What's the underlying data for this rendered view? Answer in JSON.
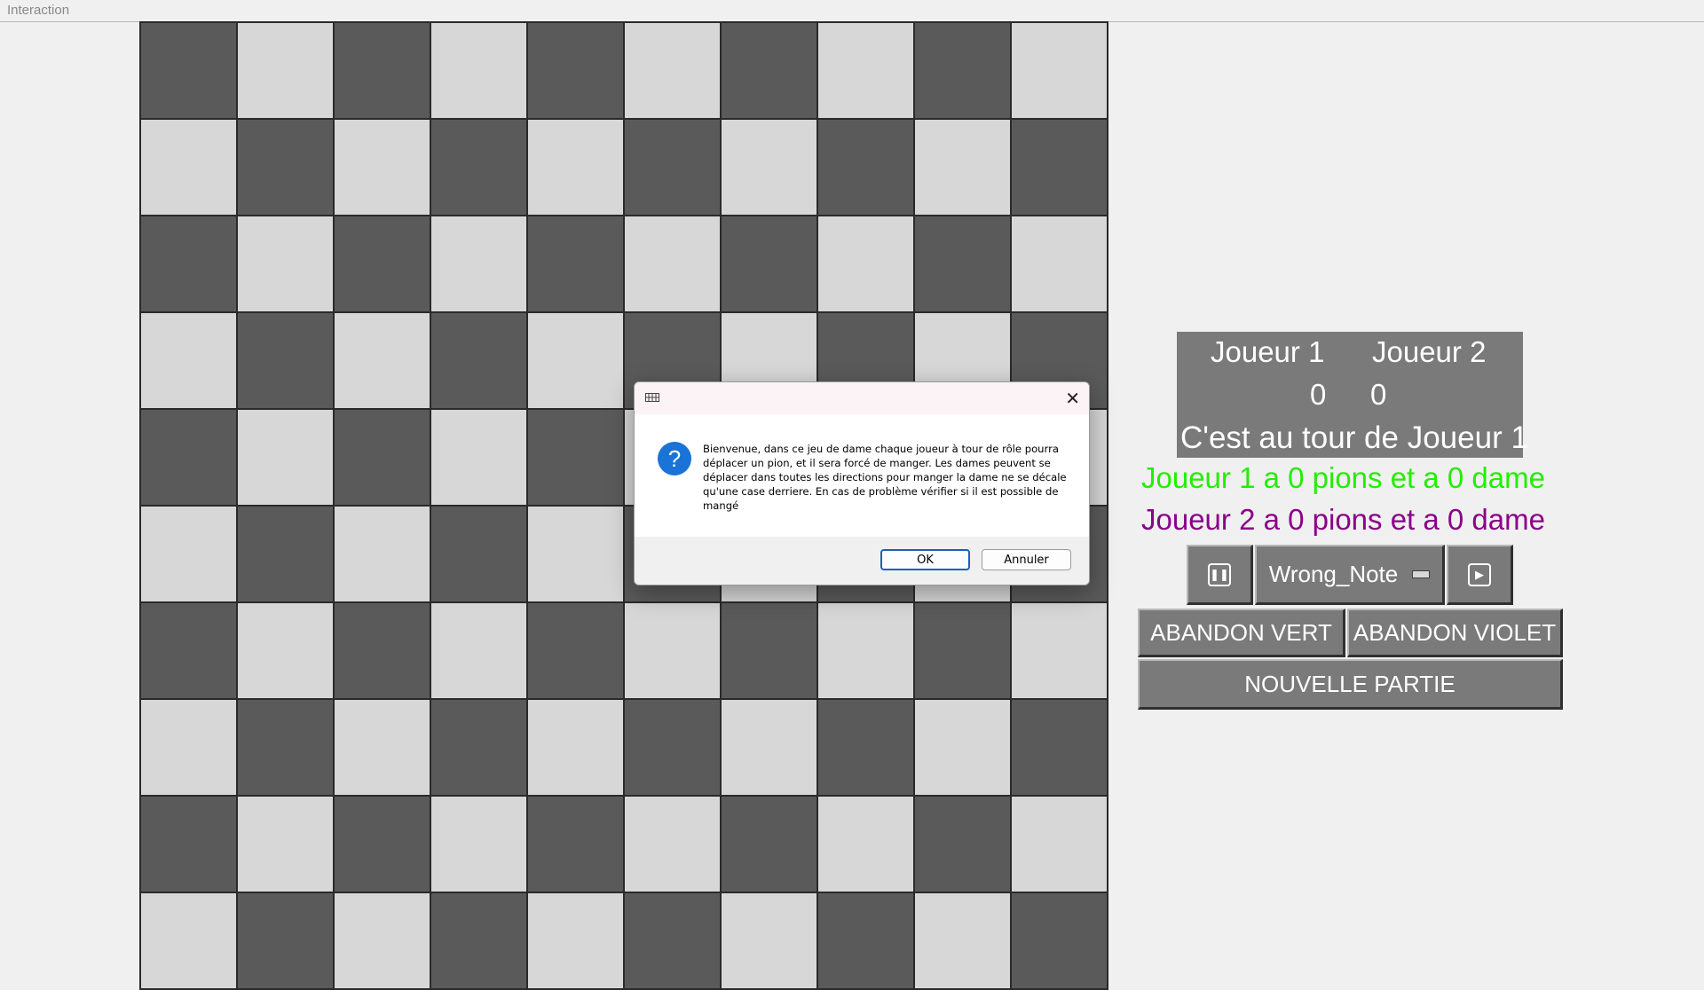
{
  "window": {
    "title": "Interaction"
  },
  "board": {
    "light_color": "#d7d7d7",
    "dark_color": "#5a5a5a"
  },
  "scores": {
    "player1_label": "Joueur 1",
    "player2_label": "Joueur 2",
    "player1_score": "0",
    "player2_score": "0",
    "turn_text": "C'est au tour de Joueur 1"
  },
  "stats": {
    "player1": "Joueur 1 a 0 pions et a 0 dame",
    "player2": "Joueur 2 a 0 pions et a 0 dame",
    "player1_color": "#22ee00",
    "player2_color": "#8a0088"
  },
  "music": {
    "track": "Wrong_Note",
    "pause_icon": "pause-icon",
    "play_icon": "play-icon"
  },
  "buttons": {
    "abandon_green": "ABANDON VERT",
    "abandon_purple": "ABANDON VIOLET",
    "new_game": "NOUVELLE PARTIE"
  },
  "dialog": {
    "icon": "question-icon",
    "message": "Bienvenue, dans ce jeu de dame chaque joueur à tour de rôle pourra déplacer un pion, et il sera forcé de manger. Les dames peuvent se déplacer dans toutes les directions pour manger la dame ne se décale qu'une case derriere. En cas de problème vérifier si il est possible de mangé",
    "ok_label": "OK",
    "cancel_label": "Annuler"
  }
}
